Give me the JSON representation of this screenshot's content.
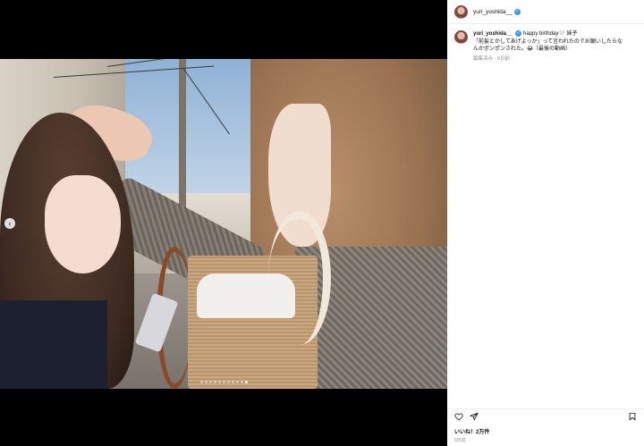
{
  "post": {
    "username": "yuri_yoshida__",
    "verified_mark": "✓",
    "carousel": {
      "prev_icon": "‹",
      "total_slides": 11,
      "active_slide": 10
    }
  },
  "caption": {
    "username": "yuri_yoshida__",
    "text_line1": "happy birthday🤍 妹子",
    "text_line2": "「前髪とかしてあげよっか」って言われたのでお願いしたらな",
    "text_line3": "んかポンポンされた。😂（最後の動画）",
    "meta": "編集済み · 6日前"
  },
  "actions": {
    "like_icon": "heart-icon",
    "share_icon": "send-icon",
    "save_icon": "bookmark-icon"
  },
  "stats": {
    "likes": "いいね！2万件",
    "date": "6日前"
  },
  "colors": {
    "verified": "#3897f0",
    "panel_bg": "#ffffff",
    "media_bg": "#000000"
  }
}
